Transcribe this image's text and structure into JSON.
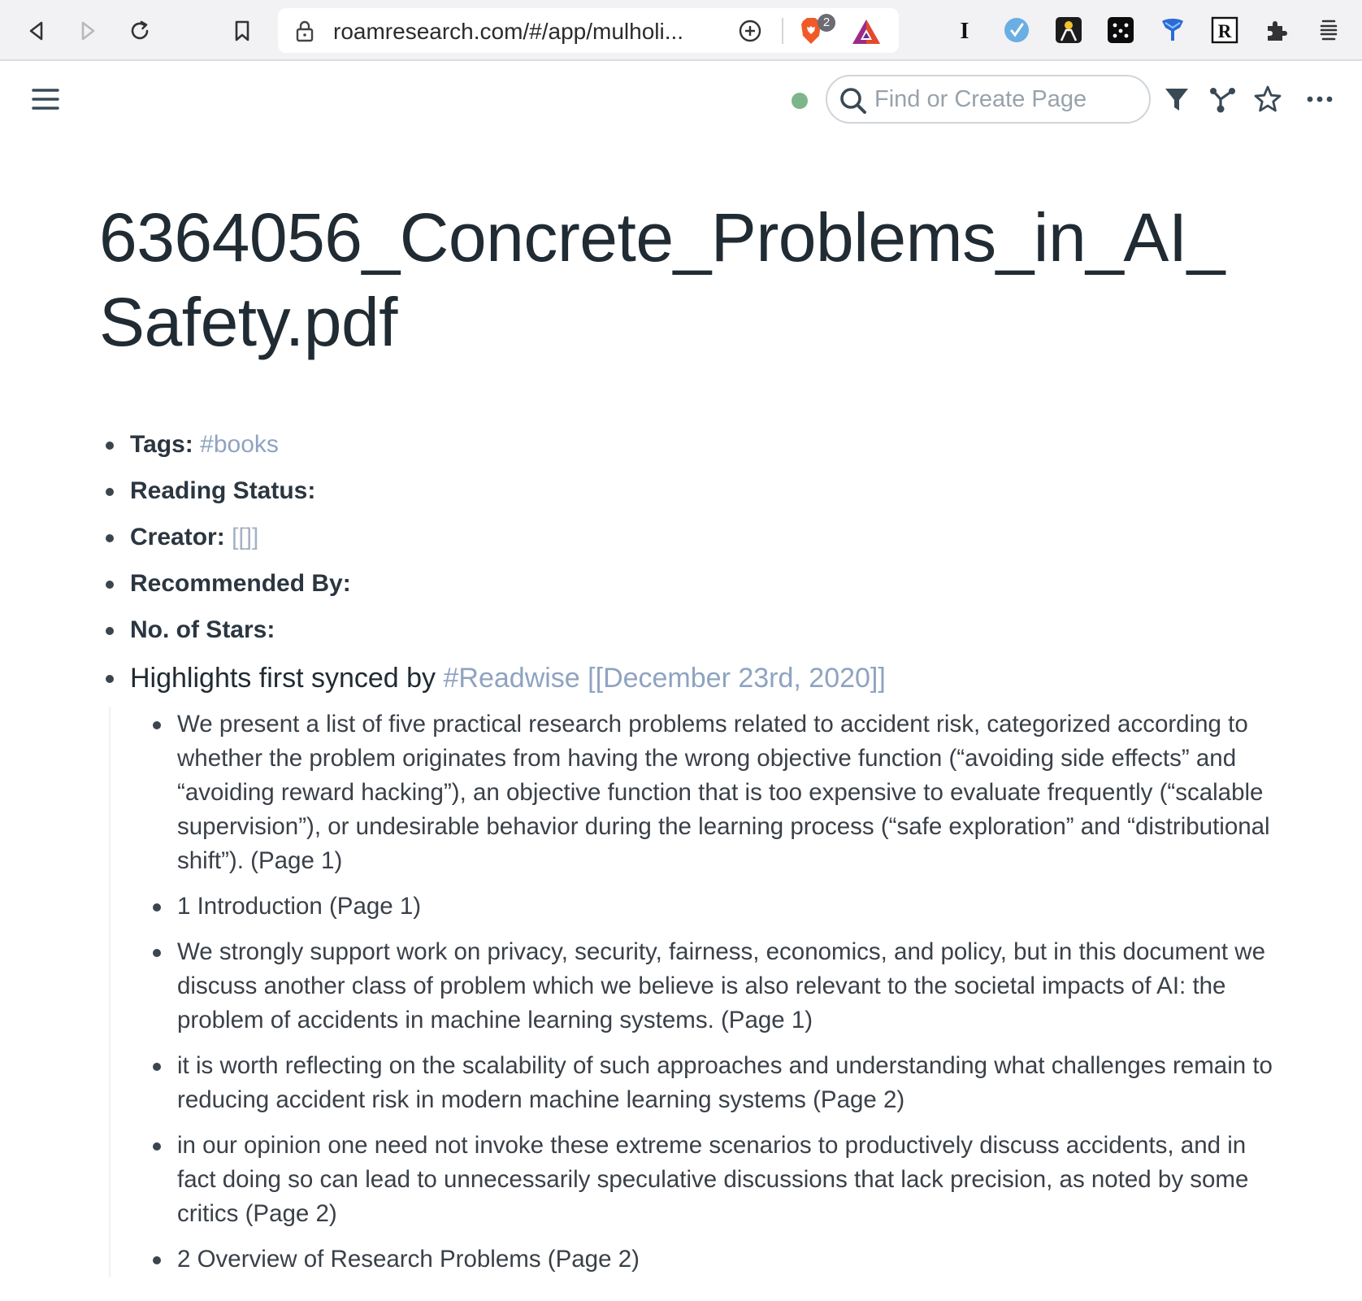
{
  "browser": {
    "url": "roamresearch.com/#/app/mulholi...",
    "brave_badge_count": "2",
    "icons": [
      "back-icon",
      "forward-icon",
      "reload-icon",
      "bookmark-icon",
      "lock-icon",
      "add-icon",
      "brave-shield-icon",
      "bat-rewards-icon",
      "ext-instapaper-icon",
      "ext-check-icon",
      "ext-person-icon",
      "ext-dots-icon",
      "ext-shield-icon",
      "ext-readwise-icon",
      "extensions-puzzle-icon",
      "browser-menu-icon"
    ],
    "ext_readwise_letter": "R",
    "ext_instapaper_letter": "I"
  },
  "topbar": {
    "search_placeholder": "Find or Create Page",
    "sync_color": "#7db68a"
  },
  "page": {
    "title": "6364056_Concrete_Problems_in_AI_Safety.pdf",
    "attributes": [
      {
        "label": "Tags:",
        "value": "#books"
      },
      {
        "label": "Reading Status:",
        "value": ""
      },
      {
        "label": "Creator:",
        "value": "[[]]"
      },
      {
        "label": "Recommended By:",
        "value": ""
      },
      {
        "label": "No. of Stars:",
        "value": ""
      }
    ],
    "highlights_header": {
      "text": "Highlights first synced by",
      "tag": "#Readwise",
      "date_link": "[[December 23rd, 2020]]"
    },
    "highlights": [
      "We present a list of five practical research problems related to accident risk, categorized according to whether the problem originates from having the wrong objective function (“avoiding side effects” and “avoiding reward hacking”), an objective function that is too expensive to evaluate frequently (“scalable supervision”), or undesirable behavior during the learning process (“safe exploration” and “distributional shift”). (Page 1)",
      "1 Introduction (Page 1)",
      "We strongly support work on privacy, security, fairness, economics, and policy, but in this document we discuss another class of problem which we believe is also relevant to the societal impacts of AI: the problem of accidents in machine learning systems. (Page 1)",
      "it is worth reflecting on the scalability of such approaches and understanding what challenges remain to reducing accident risk in modern machine learning systems (Page 2)",
      "in our opinion one need not invoke these extreme scenarios to productively discuss accidents, and in fact doing so can lead to unnecessarily speculative discussions that lack precision, as noted by some critics (Page 2)",
      "2 Overview of Research Problems (Page 2)"
    ]
  }
}
